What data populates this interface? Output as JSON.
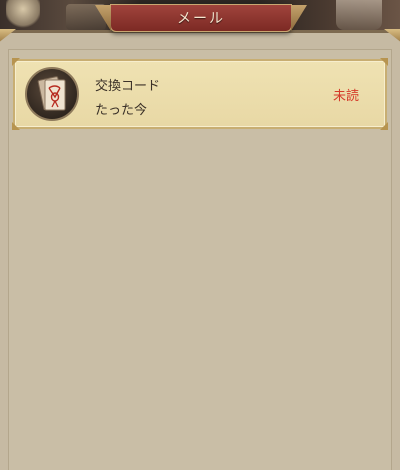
{
  "header": {
    "title": "メール"
  },
  "mail_list": [
    {
      "title": "交換コード",
      "time": "たった今",
      "status": "未読",
      "icon": "envelope-icon"
    }
  ],
  "colors": {
    "title_tab": "#8e342e",
    "panel_bg": "#c9bea6",
    "mail_card_bg": "#ecdcaa",
    "mail_card_border": "#c8ae72",
    "unread_status": "#d53a2a",
    "text": "#3b3128"
  }
}
